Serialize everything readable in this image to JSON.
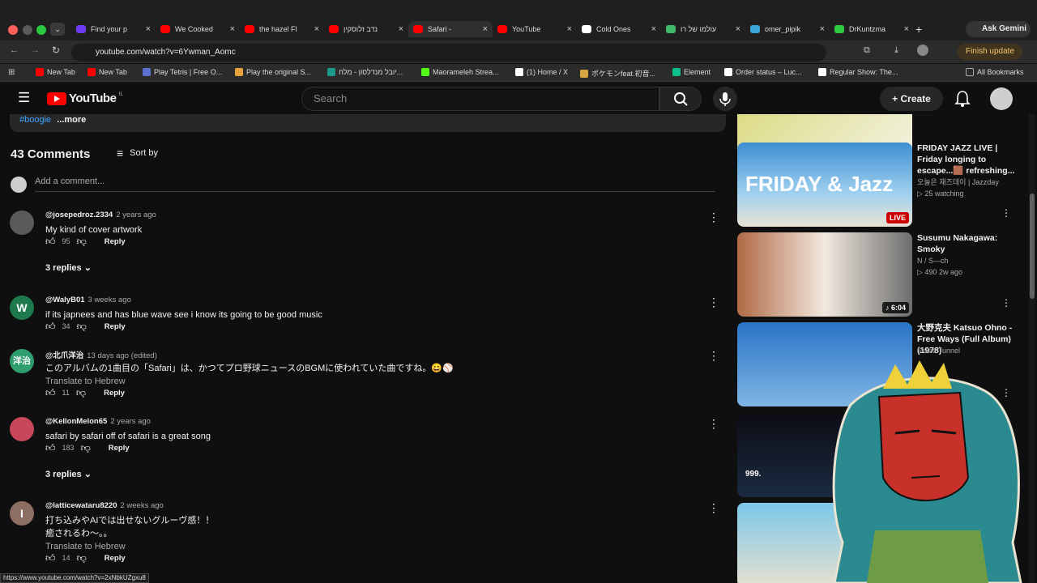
{
  "tabs": [
    {
      "title": "Find your p",
      "color": "#6e3cf0"
    },
    {
      "title": "We Cooked",
      "color": "#ff0000"
    },
    {
      "title": "the hazel Fl",
      "color": "#ff0000"
    },
    {
      "title": "נדב זלוסקין",
      "color": "#ff0000"
    },
    {
      "title": "Safari - ",
      "color": "#ff0000",
      "active": true
    },
    {
      "title": "YouTube",
      "color": "#ff0000"
    },
    {
      "title": "Cold Ones",
      "color": "#ffffff"
    },
    {
      "title": "עולמו של רו",
      "color": "#3dbb6b"
    },
    {
      "title": "omer_pipik",
      "color": "#3aa6d6"
    },
    {
      "title": "DrKuntzma",
      "color": "#2ecc40"
    }
  ],
  "ask_gemini": "Ask Gemini",
  "url": "youtube.com/watch?v=6Ywman_Aomc",
  "finish_update": "Finish update",
  "bookmarks": [
    {
      "label": "New Tab",
      "color": "#ff0000"
    },
    {
      "label": "New Tab",
      "color": "#ff0000"
    },
    {
      "label": "Play Tetris | Free O...",
      "color": "#5b6fd0"
    },
    {
      "label": "Play the original S...",
      "color": "#e8a23a"
    },
    {
      "label": "יובל מנדלסון - מלח...",
      "color": "#1f9a8a"
    },
    {
      "label": "Maorameleh Strea...",
      "color": "#53fc18"
    },
    {
      "label": "(1) Home / X",
      "color": "#ffffff"
    },
    {
      "label": "ポケモンfeat.初音...",
      "color": "#d8a640"
    },
    {
      "label": "Element",
      "color": "#0dbd8b"
    },
    {
      "label": "Order status – Luc...",
      "color": "#ffffff"
    },
    {
      "label": "Regular Show: The...",
      "color": "#ffffff"
    }
  ],
  "all_bookmarks": "All Bookmarks",
  "yt": {
    "logo": "YouTube",
    "region": "IL",
    "search_placeholder": "Search",
    "create": "Create"
  },
  "description": {
    "tag": "#boogie",
    "more": "...more"
  },
  "comments_header": {
    "count": "43 Comments",
    "sort": "Sort by",
    "add": "Add a comment..."
  },
  "comments": [
    {
      "user": "@josepedroz.2334",
      "time": "2 years ago",
      "text": "My kind of cover artwork",
      "likes": "95",
      "replies": "3 replies",
      "avatar_letter": "",
      "avatar_color": "#5a5a5a"
    },
    {
      "user": "@WalyB01",
      "time": "3 weeks ago",
      "text": "if its japnees and has blue wave see i know its going to be good music",
      "likes": "34",
      "avatar_letter": "W",
      "avatar_color": "#1e7a4c"
    },
    {
      "user": "@北爪洋治",
      "time": "13 days ago (edited)",
      "text": "このアルバムの1曲目の「Safari」は、かつてプロ野球ニュースのBGMに使われていた曲ですね。😀⚾",
      "translate": "Translate to Hebrew",
      "likes": "11",
      "avatar_letter": "洋治",
      "avatar_color": "#2e9e6e"
    },
    {
      "user": "@KellonMelon65",
      "time": "2 years ago",
      "text": "safari by safari off of safari is a great song",
      "likes": "183",
      "replies": "3 replies",
      "avatar_letter": "",
      "avatar_color": "#c9475a"
    },
    {
      "user": "@latticewataru8220",
      "time": "2 weeks ago",
      "text": "打ち込みやAIでは出せないグルーヴ感！！",
      "text2": "癒されるわ〜。。",
      "translate": "Translate to Hebrew",
      "likes": "14",
      "avatar_letter": "I",
      "avatar_color": "#8d6e63"
    }
  ],
  "reply_label": "Reply",
  "sidebar": [
    {
      "title": "",
      "meta1": "",
      "meta2": "",
      "badge": "LIVE"
    },
    {
      "title": "FRIDAY JAZZ LIVE | Friday longing to escape...🟫 refreshing...",
      "meta1": "오늘은 재즈데이 | Jazzday",
      "meta2": "▷ 25 watching",
      "badge": "LIVE",
      "thumb_text": "FRIDAY & Jazz"
    },
    {
      "title": "Susumu Nakagawa: Smoky",
      "meta1": "N / S―ch",
      "meta2": "▷ 490   2w ago",
      "badge": "♪ 6:04"
    },
    {
      "title": "大野克夫 Katsuo Ohno - Free Ways (Full Album) (1978)",
      "meta1": "Music Tunnel",
      "meta2": "",
      "badge": ""
    },
    {
      "title": "",
      "meta1": "",
      "meta2": "",
      "badge": "",
      "thumb_text": "999."
    },
    {
      "title": "",
      "meta1": "",
      "meta2": "",
      "badge": ""
    }
  ],
  "status_url": "https://www.youtube.com/watch?v=2xNbkUZgxu8"
}
